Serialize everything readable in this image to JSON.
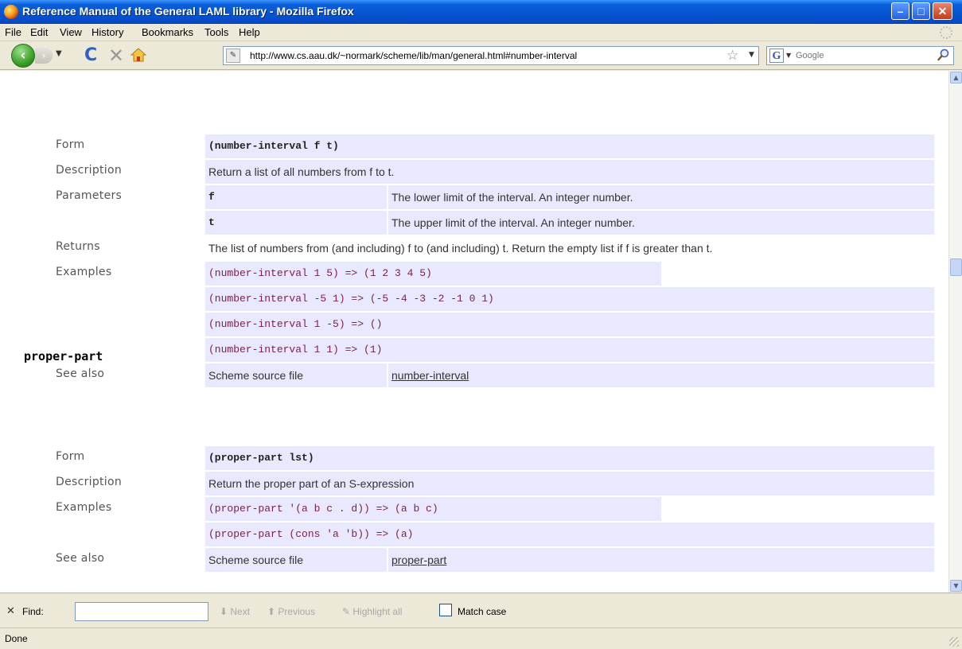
{
  "window": {
    "title": "Reference Manual of the General LAML library - Mozilla Firefox",
    "min_glyph": "–",
    "max_glyph": "□",
    "close_glyph": "✕"
  },
  "menu": [
    "File",
    "Edit",
    "View",
    "History",
    "Bookmarks",
    "Tools",
    "Help"
  ],
  "nav": {
    "url": "http://www.cs.aau.dk/~normark/scheme/lib/man/general.html#number-interval",
    "search_placeholder": "Google",
    "search_engine_letter": "G"
  },
  "labels": {
    "form": "Form",
    "description": "Description",
    "parameters": "Parameters",
    "returns": "Returns",
    "examples": "Examples",
    "see_also": "See also"
  },
  "entries": {
    "number_interval": {
      "name": "number-interval",
      "form": "(number-interval f t)",
      "description": "Return a list of all numbers from f to t.",
      "params": [
        {
          "name": "f",
          "desc": "The lower limit of the interval. An integer number."
        },
        {
          "name": "t",
          "desc": "The upper limit of the interval. An integer number."
        }
      ],
      "returns": "The list of numbers from (and including) f to (and including) t. Return the empty list if f is greater than t.",
      "examples": [
        "(number-interval 1 5) => (1 2 3 4 5)",
        "(number-interval -5 1) => (-5 -4 -3 -2 -1 0 1)",
        "(number-interval 1 -5) => ()",
        "(number-interval 1 1) => (1)"
      ],
      "see_also_kind": "Scheme source file",
      "see_also_link": "number-interval"
    },
    "proper_part": {
      "name": "proper-part",
      "form": "(proper-part lst)",
      "description": "Return the proper part of an S-expression",
      "examples": [
        "(proper-part '(a b c . d)) => (a b c)",
        "(proper-part (cons 'a 'b)) => (a)"
      ],
      "see_also_kind": "Scheme source file",
      "see_also_link": "proper-part"
    }
  },
  "findbar": {
    "close_glyph": "✕",
    "label": "Find:",
    "next": "Next",
    "previous": "Previous",
    "highlight": "Highlight all",
    "match_case": "Match case"
  },
  "status": "Done"
}
